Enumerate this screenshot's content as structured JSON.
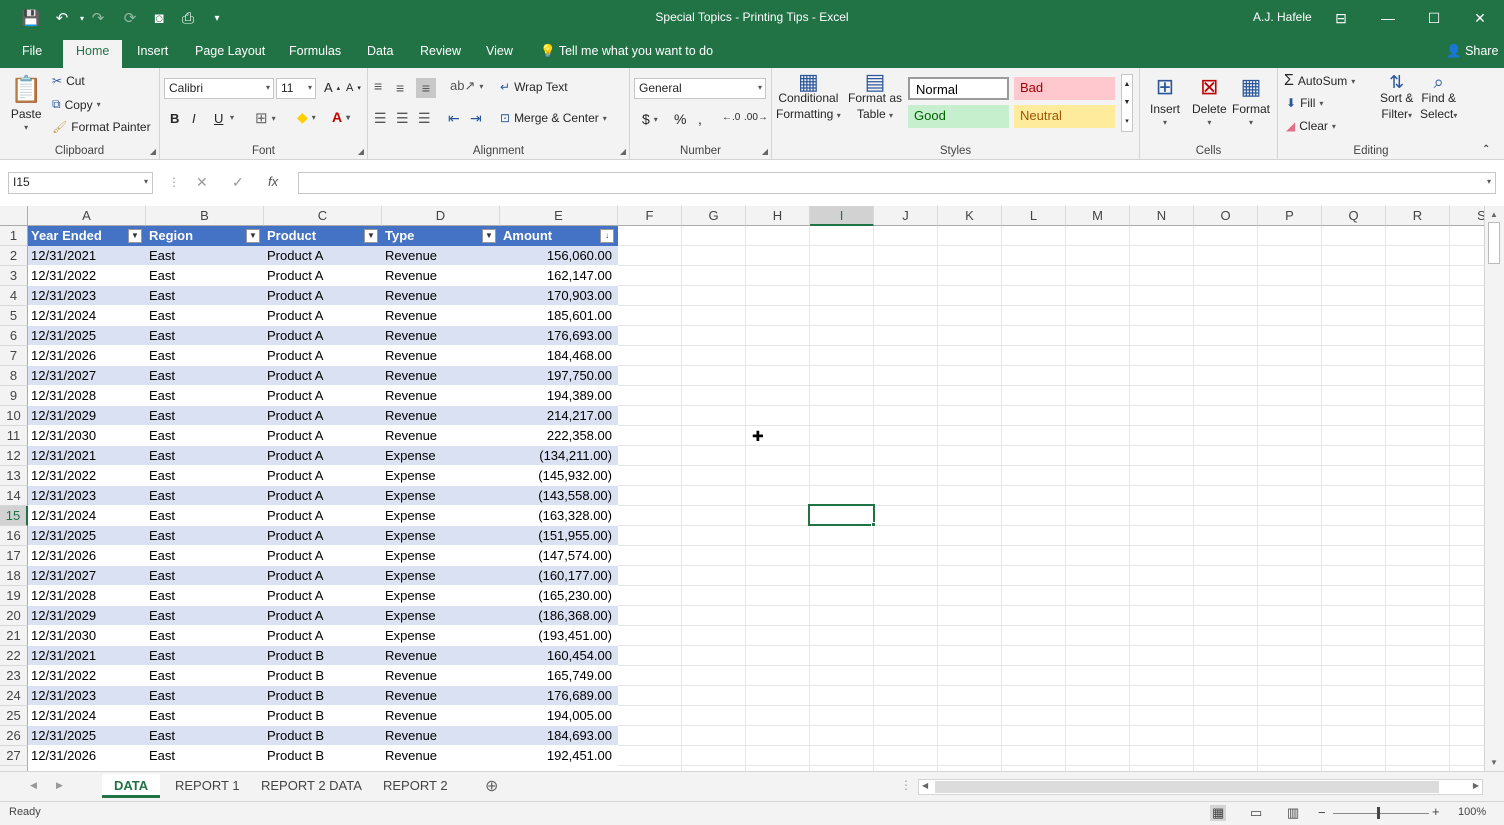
{
  "app": {
    "title": "Special Topics - Printing Tips  -  Excel",
    "user": "A.J. Hafele"
  },
  "ribbon_tabs": [
    "File",
    "Home",
    "Insert",
    "Page Layout",
    "Formulas",
    "Data",
    "Review",
    "View"
  ],
  "tell_me": "Tell me what you want to do",
  "share": "Share",
  "clipboard": {
    "paste": "Paste",
    "cut": "Cut",
    "copy": "Copy",
    "format_painter": "Format Painter",
    "label": "Clipboard"
  },
  "font": {
    "name": "Calibri",
    "size": "11",
    "label": "Font",
    "bold": "B",
    "italic": "I",
    "underline": "U"
  },
  "alignment": {
    "wrap": "Wrap Text",
    "merge": "Merge & Center",
    "label": "Alignment"
  },
  "number": {
    "format": "General",
    "label": "Number"
  },
  "styles": {
    "cond1": "Conditional",
    "cond2": "Formatting",
    "fmt1": "Format as",
    "fmt2": "Table",
    "normal": "Normal",
    "bad": "Bad",
    "good": "Good",
    "neutral": "Neutral",
    "label": "Styles"
  },
  "cells": {
    "insert": "Insert",
    "delete": "Delete",
    "format": "Format",
    "label": "Cells"
  },
  "editing": {
    "autosum": "AutoSum",
    "fill": "Fill",
    "clear": "Clear",
    "sort1": "Sort &",
    "sort2": "Filter",
    "find1": "Find &",
    "find2": "Select",
    "label": "Editing"
  },
  "namebox": "I15",
  "columns": [
    "A",
    "B",
    "C",
    "D",
    "E",
    "F",
    "G",
    "H",
    "I",
    "J",
    "K",
    "L",
    "M",
    "N",
    "O",
    "P",
    "Q",
    "R",
    "S"
  ],
  "headers": [
    "Year Ended",
    "Region",
    "Product",
    "Type",
    "Amount"
  ],
  "rows": [
    [
      "12/31/2021",
      "East",
      "Product A",
      "Revenue",
      "156,060.00"
    ],
    [
      "12/31/2022",
      "East",
      "Product A",
      "Revenue",
      "162,147.00"
    ],
    [
      "12/31/2023",
      "East",
      "Product A",
      "Revenue",
      "170,903.00"
    ],
    [
      "12/31/2024",
      "East",
      "Product A",
      "Revenue",
      "185,601.00"
    ],
    [
      "12/31/2025",
      "East",
      "Product A",
      "Revenue",
      "176,693.00"
    ],
    [
      "12/31/2026",
      "East",
      "Product A",
      "Revenue",
      "184,468.00"
    ],
    [
      "12/31/2027",
      "East",
      "Product A",
      "Revenue",
      "197,750.00"
    ],
    [
      "12/31/2028",
      "East",
      "Product A",
      "Revenue",
      "194,389.00"
    ],
    [
      "12/31/2029",
      "East",
      "Product A",
      "Revenue",
      "214,217.00"
    ],
    [
      "12/31/2030",
      "East",
      "Product A",
      "Revenue",
      "222,358.00"
    ],
    [
      "12/31/2021",
      "East",
      "Product A",
      "Expense",
      "(134,211.00)"
    ],
    [
      "12/31/2022",
      "East",
      "Product A",
      "Expense",
      "(145,932.00)"
    ],
    [
      "12/31/2023",
      "East",
      "Product A",
      "Expense",
      "(143,558.00)"
    ],
    [
      "12/31/2024",
      "East",
      "Product A",
      "Expense",
      "(163,328.00)"
    ],
    [
      "12/31/2025",
      "East",
      "Product A",
      "Expense",
      "(151,955.00)"
    ],
    [
      "12/31/2026",
      "East",
      "Product A",
      "Expense",
      "(147,574.00)"
    ],
    [
      "12/31/2027",
      "East",
      "Product A",
      "Expense",
      "(160,177.00)"
    ],
    [
      "12/31/2028",
      "East",
      "Product A",
      "Expense",
      "(165,230.00)"
    ],
    [
      "12/31/2029",
      "East",
      "Product A",
      "Expense",
      "(186,368.00)"
    ],
    [
      "12/31/2030",
      "East",
      "Product A",
      "Expense",
      "(193,451.00)"
    ],
    [
      "12/31/2021",
      "East",
      "Product B",
      "Revenue",
      "160,454.00"
    ],
    [
      "12/31/2022",
      "East",
      "Product B",
      "Revenue",
      "165,749.00"
    ],
    [
      "12/31/2023",
      "East",
      "Product B",
      "Revenue",
      "176,689.00"
    ],
    [
      "12/31/2024",
      "East",
      "Product B",
      "Revenue",
      "194,005.00"
    ],
    [
      "12/31/2025",
      "East",
      "Product B",
      "Revenue",
      "184,693.00"
    ],
    [
      "12/31/2026",
      "East",
      "Product B",
      "Revenue",
      "192,451.00"
    ]
  ],
  "sheets": [
    "DATA",
    "REPORT 1",
    "REPORT 2 DATA",
    "REPORT 2"
  ],
  "status": {
    "ready": "Ready",
    "zoom": "100%"
  }
}
